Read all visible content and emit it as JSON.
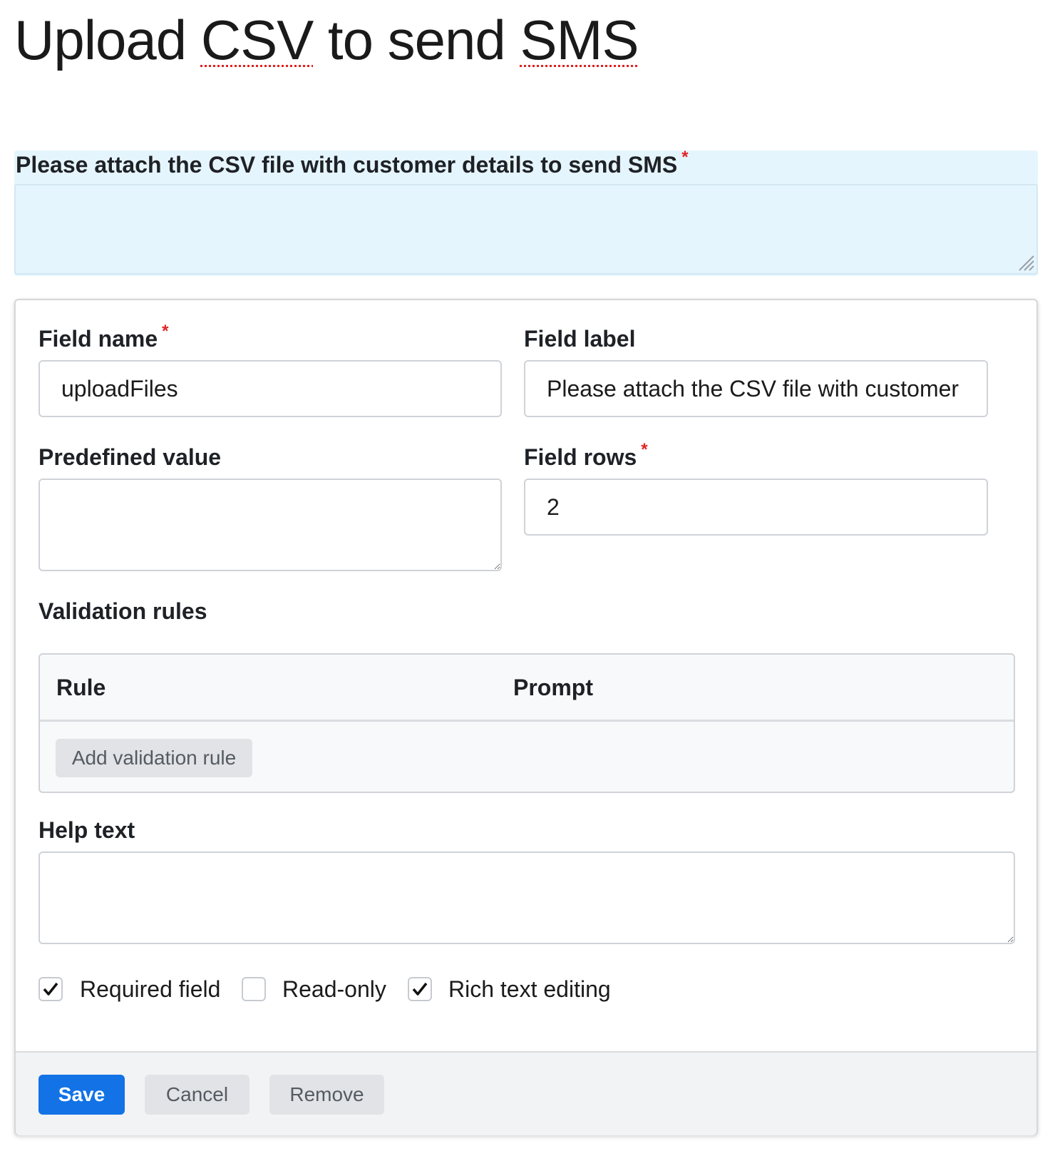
{
  "page": {
    "title_parts": [
      "Upload ",
      "CSV",
      " to ",
      "send ",
      "SMS"
    ]
  },
  "preview": {
    "label": "Please attach the CSV file with customer details to send SMS",
    "required_mark": "*"
  },
  "form": {
    "field_name": {
      "label": "Field name",
      "required_mark": "*",
      "value": "uploadFiles"
    },
    "field_label": {
      "label": "Field label",
      "value": "Please attach the CSV file with customer details to send SMS"
    },
    "predefined_value": {
      "label": "Predefined value",
      "value": ""
    },
    "field_rows": {
      "label": "Field rows",
      "required_mark": "*",
      "value": "2"
    },
    "validation": {
      "label": "Validation rules",
      "columns": [
        "Rule",
        "Prompt"
      ],
      "add_button": "Add validation rule"
    },
    "help_text": {
      "label": "Help text",
      "value": ""
    },
    "checkboxes": [
      {
        "label": "Required field",
        "checked": true
      },
      {
        "label": "Read-only",
        "checked": false
      },
      {
        "label": "Rich text editing",
        "checked": true
      }
    ]
  },
  "footer": {
    "save": "Save",
    "cancel": "Cancel",
    "remove": "Remove"
  },
  "colors": {
    "primary": "#1272e6",
    "required": "#e02424",
    "preview_bg": "#e5f5fd"
  }
}
